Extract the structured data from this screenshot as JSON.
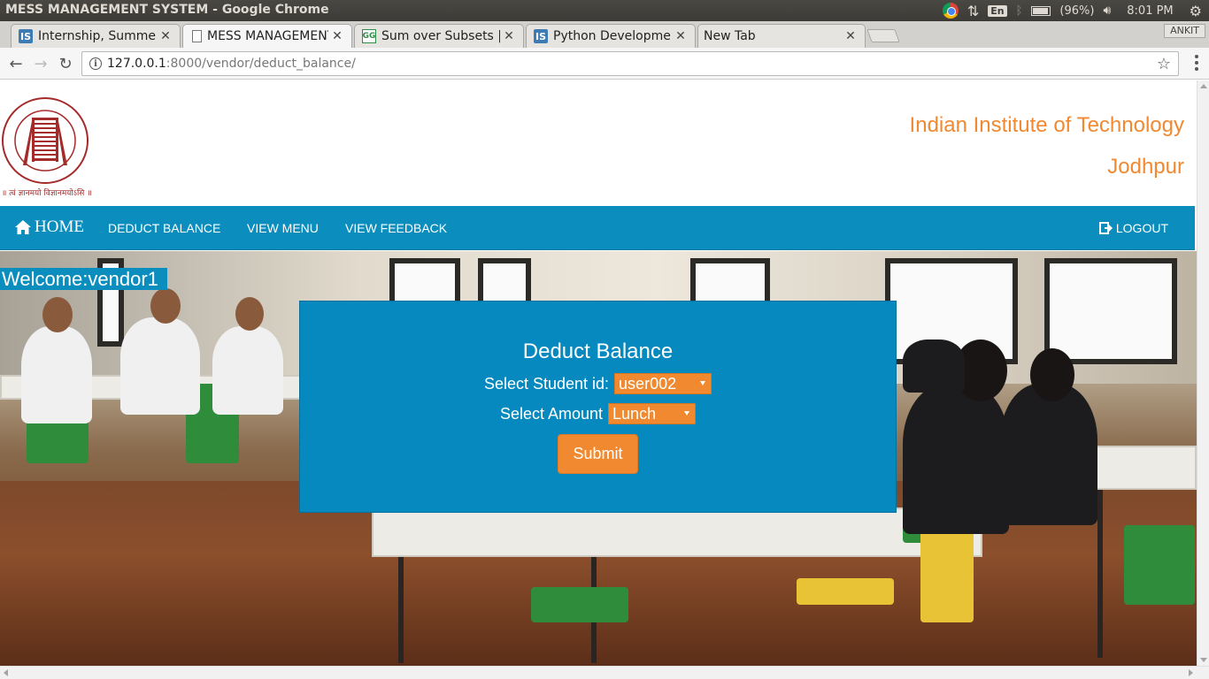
{
  "os": {
    "window_title": "MESS MANAGEMENT SYSTEM - Google Chrome",
    "keyboard_layout": "En",
    "battery": "(96%)",
    "clock": "8:01 PM"
  },
  "browser": {
    "tabs": [
      {
        "label": "Internship, Summer",
        "favicon": "is-favicon"
      },
      {
        "label": "MESS MANAGEMENT",
        "favicon": "document-icon"
      },
      {
        "label": "Sum over Subsets |",
        "favicon": "gfg-favicon"
      },
      {
        "label": "Python Developme",
        "favicon": "is-favicon"
      },
      {
        "label": "New Tab",
        "favicon": ""
      }
    ],
    "active_tab_index": 1,
    "profile_name": "ANKIT",
    "url_host": "127.0.0.1",
    "url_rest": ":8000/vendor/deduct_balance/"
  },
  "header": {
    "logo_text": "॥ त्वं ज्ञानमयो विज्ञानमयोऽसि ॥",
    "institute_line1": "Indian Institute of Technology",
    "institute_line2": "Jodhpur"
  },
  "nav": {
    "home": "HOME",
    "items": [
      "DEDUCT BALANCE",
      "VIEW MENU",
      "VIEW FEEDBACK"
    ],
    "logout": "LOGOUT"
  },
  "welcome": "Welcome:vendor1",
  "form": {
    "title": "Deduct Balance",
    "student_label": "Select Student id:",
    "student_value": "user002",
    "amount_label": "Select Amount",
    "amount_value": "Lunch",
    "submit_label": "Submit"
  },
  "colors": {
    "primary_blue": "#0b8dbd",
    "accent_orange": "#f0892f"
  }
}
